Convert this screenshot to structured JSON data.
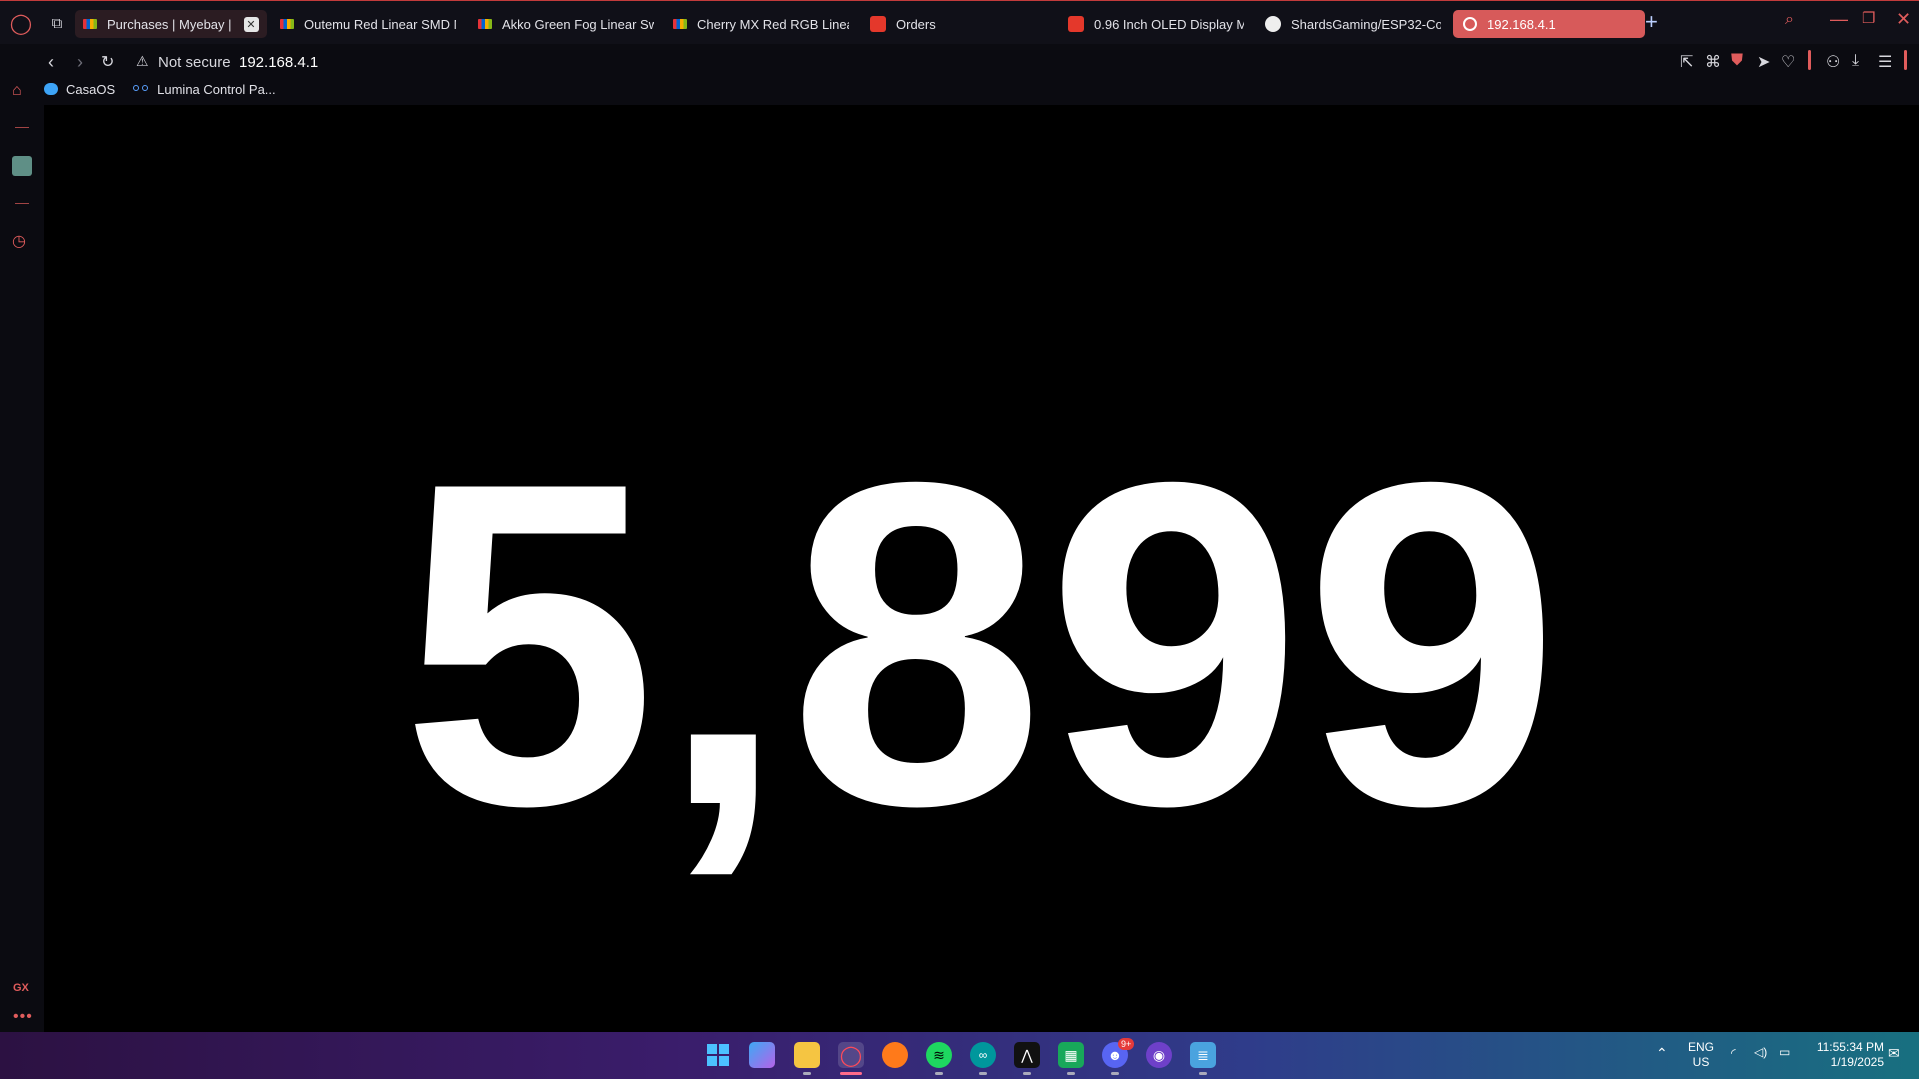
{
  "browser": {
    "tabs": [
      {
        "label": "Purchases | Myebay |",
        "icon": "ebay-icon"
      },
      {
        "label": "Outemu Red Linear SMD M",
        "icon": "ebay-icon"
      },
      {
        "label": "Akko Green Fog Linear Sw",
        "icon": "ebay-icon"
      },
      {
        "label": "Cherry MX Red RGB Linea",
        "icon": "ebay-icon"
      },
      {
        "label": "Orders",
        "icon": "aliexpress-icon"
      },
      {
        "label": "0.96 Inch OLED Display M",
        "icon": "aliexpress-icon"
      },
      {
        "label": "ShardsGaming/ESP32-Co",
        "icon": "github-icon"
      },
      {
        "label": "192.168.4.1",
        "icon": "globe-icon"
      }
    ],
    "active_tab_index": 7,
    "security_label": "Not secure",
    "url": "192.168.4.1",
    "bookmarks": [
      {
        "label": "CasaOS",
        "icon": "casaos-icon"
      },
      {
        "label": "Lumina Control Pa...",
        "icon": "lumina-icon"
      }
    ],
    "sidebar_badge": "GX",
    "sidebar_more": "•••"
  },
  "page": {
    "counter": "5,899"
  },
  "taskbar": {
    "language": "ENG",
    "region": "US",
    "time": "11:55:34 PM",
    "date": "1/19/2025",
    "discord_badge": "9+"
  },
  "colors": {
    "accent": "#e05c5c",
    "active_tab": "#d75a5a",
    "page_background": "#000000",
    "counter_text": "#ffffff"
  }
}
